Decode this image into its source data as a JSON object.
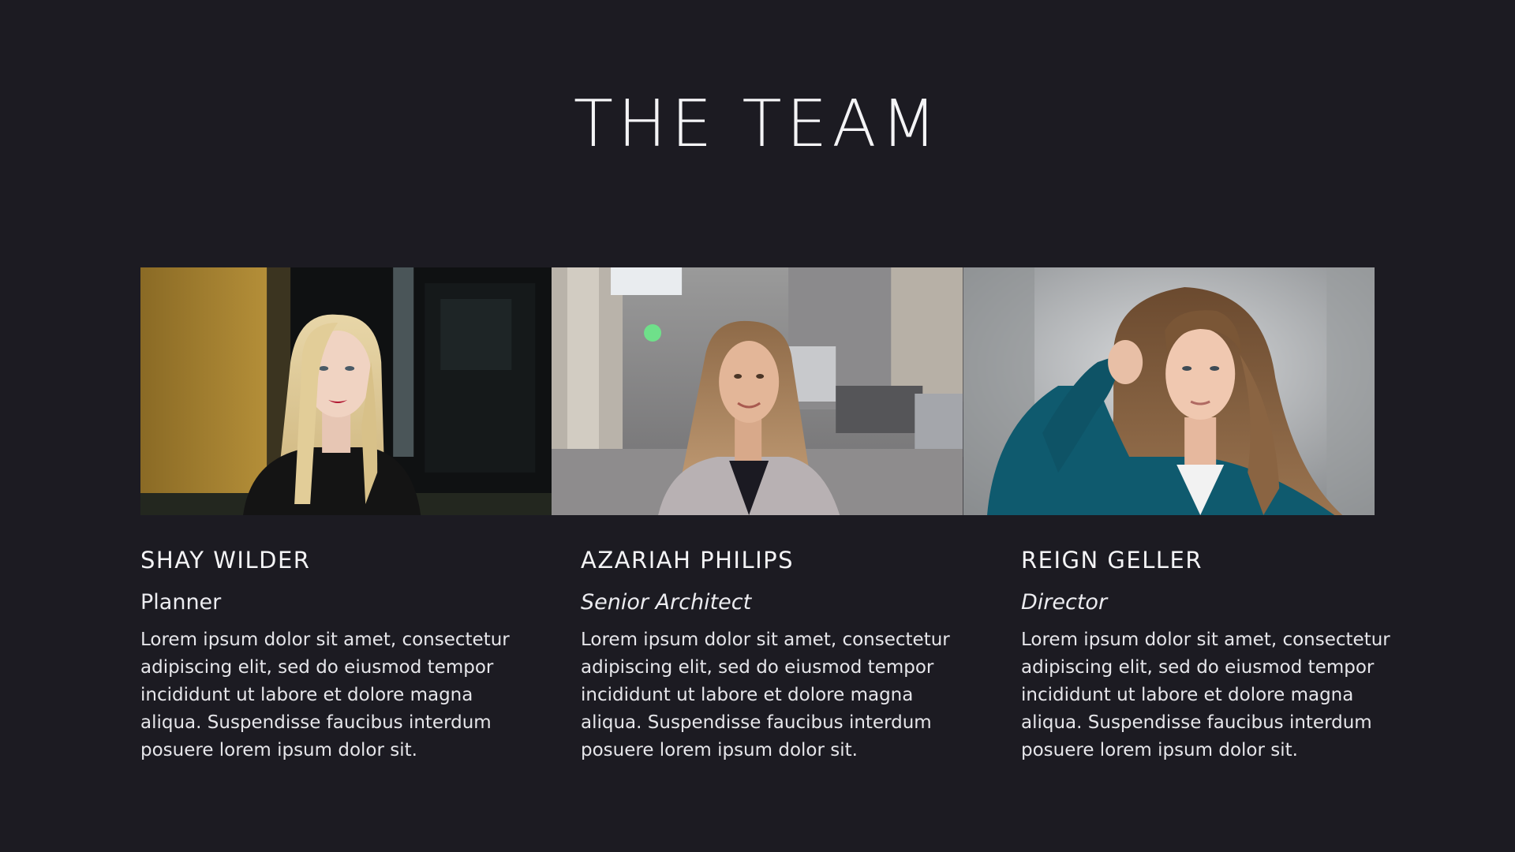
{
  "slide": {
    "title": "THE TEAM",
    "background_color": "#1c1b22",
    "text_color": "#f4f4f6"
  },
  "team": [
    {
      "name": "SHAY WILDER",
      "role": "Planner",
      "role_style": "normal",
      "bio": "Lorem ipsum dolor sit amet, consectetur adipiscing elit, sed do eiusmod tempor incididunt ut labore et dolore magna aliqua. Suspendisse faucibus interdum posuere lorem ipsum dolor sit.",
      "photo_icon": "portrait-photo"
    },
    {
      "name": "AZARIAH PHILIPS",
      "role": "Senior Architect",
      "role_style": "italic",
      "bio": "Lorem ipsum dolor sit amet, consectetur adipiscing elit, sed do eiusmod tempor incididunt ut labore et dolore magna aliqua. Suspendisse faucibus interdum posuere lorem ipsum dolor sit.",
      "photo_icon": "portrait-photo"
    },
    {
      "name": "REIGN GELLER",
      "role": "Director",
      "role_style": "italic",
      "bio": "Lorem ipsum dolor sit amet, consectetur adipiscing elit, sed do eiusmod tempor incididunt ut labore et dolore magna aliqua. Suspendisse faucibus interdum posuere lorem ipsum dolor sit.",
      "photo_icon": "portrait-photo"
    }
  ]
}
